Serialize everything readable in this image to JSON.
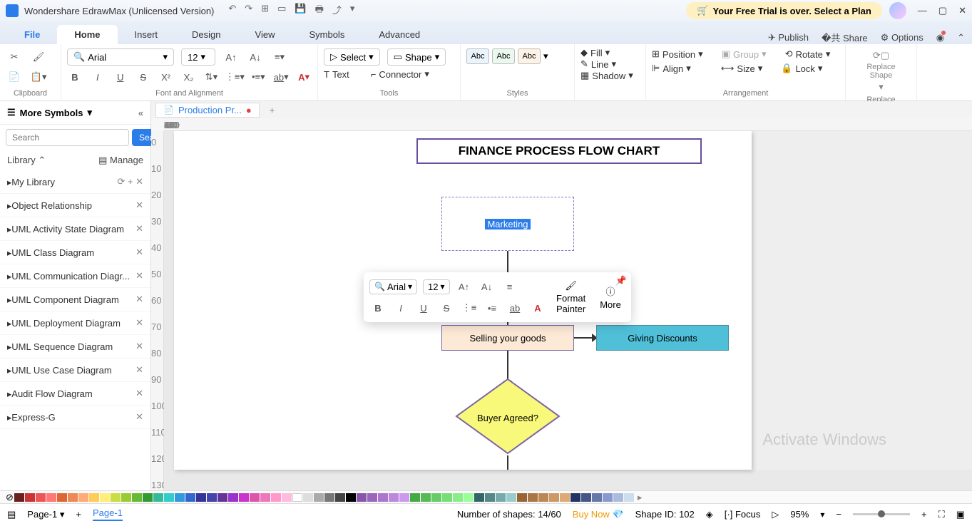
{
  "title": "Wondershare EdrawMax (Unlicensed Version)",
  "trial_banner": "Your Free Trial is over. Select a Plan",
  "file_tab": "File",
  "tabs": [
    "Home",
    "Insert",
    "Design",
    "View",
    "Symbols",
    "Advanced"
  ],
  "right_actions": {
    "publish": "Publish",
    "share": "Share",
    "options": "Options"
  },
  "ribbon": {
    "clipboard": "Clipboard",
    "font_name": "Arial",
    "font_size": "12",
    "font_group": "Font and Alignment",
    "select": "Select",
    "shape": "Shape",
    "text": "Text",
    "connector": "Connector",
    "tools": "Tools",
    "styles": "Styles",
    "abc": "Abc",
    "fill": "Fill",
    "line": "Line",
    "shadow": "Shadow",
    "position": "Position",
    "align": "Align",
    "group": "Group",
    "size": "Size",
    "rotate": "Rotate",
    "lock": "Lock",
    "arrangement": "Arrangement",
    "replace_shape": "Replace\nShape",
    "replace": "Replace"
  },
  "sidebar": {
    "more_symbols": "More Symbols",
    "search_ph": "Search",
    "search_btn": "Search",
    "library": "Library",
    "manage": "Manage",
    "mylib": "My Library",
    "items": [
      "Object Relationship",
      "UML Activity State Diagram",
      "UML Class Diagram",
      "UML Communication Diagr...",
      "UML Component Diagram",
      "UML Deployment Diagram",
      "UML Sequence Diagram",
      "UML Use Case Diagram",
      "Audit Flow Diagram",
      "Express-G"
    ]
  },
  "doctab": "Production Pr...",
  "chart": {
    "title": "FINANCE PROCESS FLOW CHART",
    "marketing": "Marketing",
    "selling": "Selling your goods",
    "discounts": "Giving Discounts",
    "buyer": "Buyer Agreed?"
  },
  "float": {
    "font": "Arial",
    "size": "12",
    "format_painter": "Format\nPainter",
    "more": "More"
  },
  "status": {
    "page": "Page-1",
    "page_tab": "Page-1",
    "shapes": "Number of shapes: 14/60",
    "buy": "Buy Now",
    "shape_id": "Shape ID: 102",
    "focus": "Focus",
    "zoom": "95%"
  },
  "watermark": "Activate Windows"
}
